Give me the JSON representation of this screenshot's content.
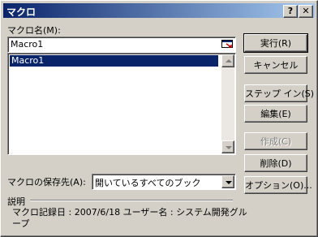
{
  "window": {
    "title": "マクロ",
    "help_label": "?",
    "close_label": "✕"
  },
  "macro_name": {
    "label": "マクロ名(M):",
    "value": "Macro1",
    "icon": "select-range-icon"
  },
  "macro_list": {
    "items": [
      "Macro1"
    ],
    "selected_index": 0
  },
  "buttons": {
    "run": "実行(R)",
    "cancel": "キャンセル",
    "step_into": "ステップ イン(S)",
    "edit": "編集(E)",
    "create": "作成(C)",
    "delete": "削除(D)",
    "options": "オプション(O)..."
  },
  "store_in": {
    "label": "マクロの保存先(A):",
    "value": "開いているすべてのブック"
  },
  "description": {
    "label": "説明",
    "text": "マクロ記録日 : 2007/6/18  ユーザー名 : システム開発グループ"
  }
}
